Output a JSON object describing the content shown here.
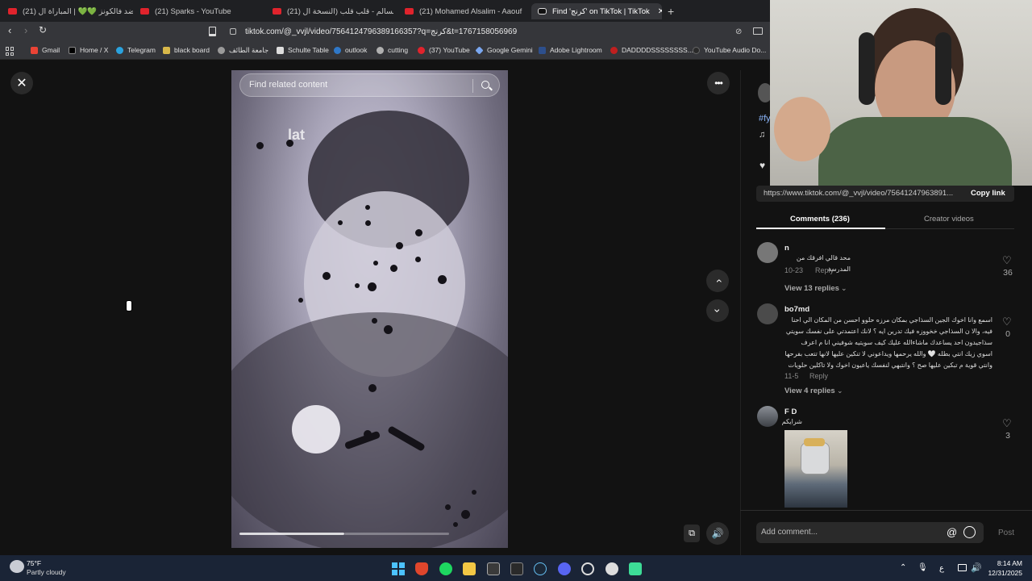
{
  "browser": {
    "tabs": [
      {
        "label": "باور ضد فالكونز 💚💚 | المباراة ال (21)",
        "active": false
      },
      {
        "label": "(21) Sparks - YouTube",
        "active": false
      },
      {
        "label": "(21) محمد السالم - قلب قلب (النسخة ال",
        "active": false
      },
      {
        "label": "(21) Mohamed Alsalim - Aaouf El Dei",
        "active": false
      },
      {
        "label": "Find 'كرنج' on TikTok | TikTok",
        "active": true
      }
    ],
    "new_tab_label": "+",
    "url": "tiktok.com/@_vvjl/video/7564124796389166357?q=كرنج&t=1767158056969",
    "bookmarks": [
      {
        "label": "Gmail",
        "color": "#ea4335"
      },
      {
        "label": "Home / X",
        "color": "#222222"
      },
      {
        "label": "Telegram",
        "color": "#2aa3df"
      },
      {
        "label": "black board",
        "color": "#d8b84a"
      },
      {
        "label": "جامعة الطائف",
        "color": "#9a9a9a"
      },
      {
        "label": "Schulte Table",
        "color": "#dddddd"
      },
      {
        "label": "outlook",
        "color": "#2f78c8"
      },
      {
        "label": "cutting",
        "color": "#b0b0b0"
      },
      {
        "label": "(37) YouTube",
        "color": "#e0232c"
      },
      {
        "label": "Google Gemini",
        "color": "#7aa7f0"
      },
      {
        "label": "Adobe Lightroom",
        "color": "#2d4f8c"
      },
      {
        "label": "DADDDDSSSSSSSS...",
        "color": "#c01f1f"
      },
      {
        "label": "YouTube Audio Do...",
        "color": "#2a2a2a"
      }
    ]
  },
  "video": {
    "search_placeholder": "Find related content",
    "watermark_text": "lat"
  },
  "panel": {
    "caption_tag": "#fy",
    "music_glyph": "♫",
    "link_url": "https://www.tiktok.com/@_vvjl/video/75641247963891...",
    "copy_link_label": "Copy link",
    "tabs": {
      "comments": "Comments (236)",
      "creator": "Creator videos"
    },
    "comments": [
      {
        "user": "n",
        "text": "محد قالي افرقك من المدرسة",
        "date": "10-23",
        "reply": "Reply",
        "likes": "36",
        "view_replies": "View 13 replies"
      },
      {
        "user": "bo7md",
        "text": "اسمع وانا اخوك الجين السذاجي بمكان مرزه حلوو احسن من المكان الي احنا فيه، والا ن السذاجي خخووزه فيك تدرين ايه ؟ لانك اعتمدتي على نفسك سويتي سذاجيدون احد يساعدك ماشاءالله عليك كيف سويتيه شوفيني انا م اعرف اسوي زيك انتي بطله 🤍 والله يرحمها ويداعوني لا تنكين عليها لانها تتعب بفرحها وانتي قوية م تبكين عليها صح ؟ وانتبهي لنفسك ياعيون اخوك ولا تاكلين حلويات كثير طيب ؟",
        "date": "11-5",
        "reply": "Reply",
        "likes": "0",
        "view_replies": "View 4 replies"
      },
      {
        "user": "F D",
        "text": "شرايكم",
        "likes": "3"
      }
    ],
    "add_comment_placeholder": "Add comment...",
    "post_label": "Post"
  },
  "taskbar": {
    "weather_temp": "75°F",
    "weather_desc": "Partly cloudy",
    "lang": "ع",
    "time": "8:14 AM",
    "date": "12/31/2025"
  }
}
